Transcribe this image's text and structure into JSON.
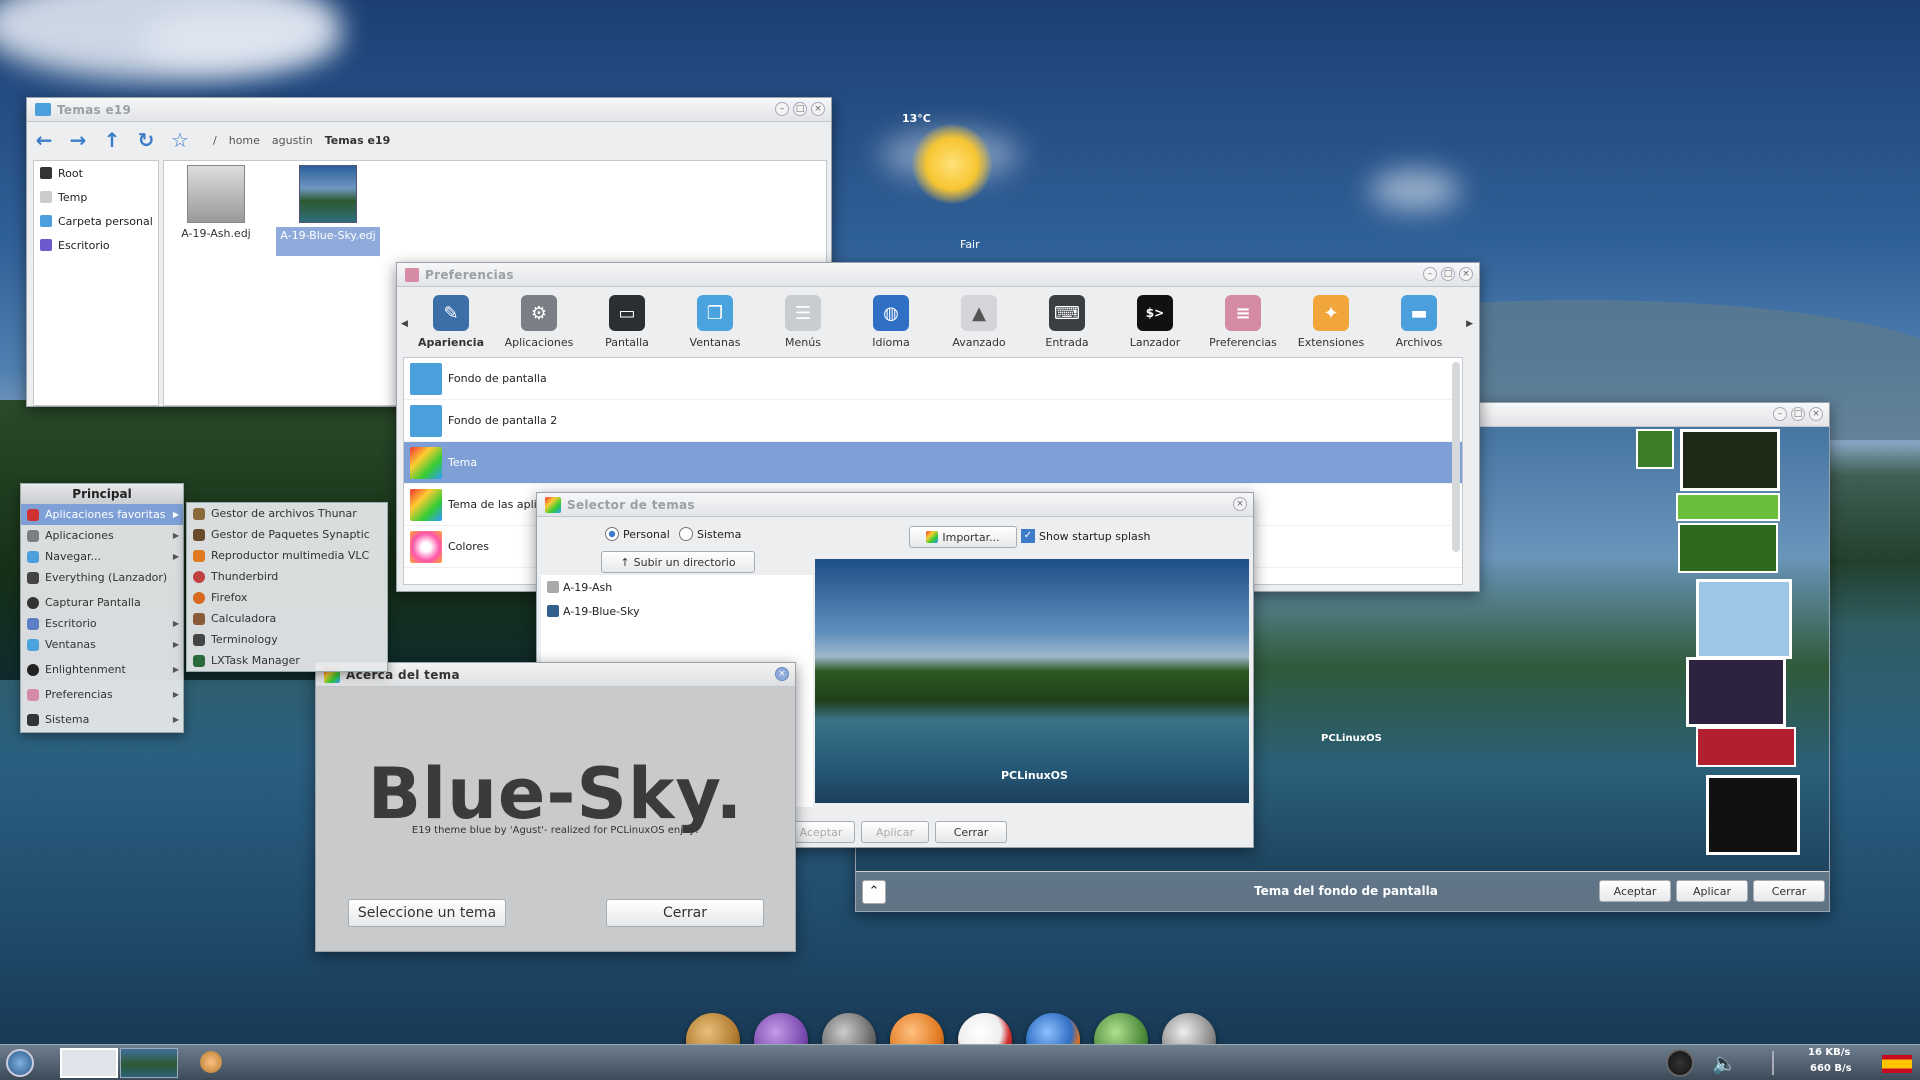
{
  "weather": {
    "temp": "13°C",
    "condition": "Fair"
  },
  "file_manager": {
    "title": "Temas e19",
    "path": [
      "/",
      "home",
      "agustin",
      "Temas e19"
    ],
    "sidebar": [
      "Root",
      "Temp",
      "Carpeta personal",
      "Escritorio"
    ],
    "files": [
      {
        "name": "A-19-Ash.edj",
        "selected": false
      },
      {
        "name": "A-19-Blue-Sky.edj",
        "selected": true
      }
    ]
  },
  "prefs": {
    "title": "Preferencias",
    "tabs": [
      {
        "label": "Apariencia",
        "icon": "appearance-icon",
        "color": "#3c6ea8"
      },
      {
        "label": "Aplicaciones",
        "icon": "gear-icon",
        "color": "#7a7f86"
      },
      {
        "label": "Pantalla",
        "icon": "screen-icon",
        "color": "#2b2f34"
      },
      {
        "label": "Ventanas",
        "icon": "windows-icon",
        "color": "#4aa3df"
      },
      {
        "label": "Menús",
        "icon": "menus-icon",
        "color": "#c9ccd0"
      },
      {
        "label": "Idioma",
        "icon": "language-icon",
        "color": "#2f6fc4"
      },
      {
        "label": "Avanzado",
        "icon": "rocket-icon",
        "color": "#d3d5d8"
      },
      {
        "label": "Entrada",
        "icon": "keyboard-icon",
        "color": "#3b3f44"
      },
      {
        "label": "Lanzador",
        "icon": "terminal-icon",
        "color": "#111111"
      },
      {
        "label": "Preferencias",
        "icon": "toggles-icon",
        "color": "#d58aa6"
      },
      {
        "label": "Extensiones",
        "icon": "puzzle-icon",
        "color": "#f0a63b"
      },
      {
        "label": "Archivos",
        "icon": "folder-icon",
        "color": "#4b9fdc"
      }
    ],
    "items": [
      {
        "label": "Fondo de pantalla",
        "selected": false
      },
      {
        "label": "Fondo de pantalla 2",
        "selected": false
      },
      {
        "label": "Tema",
        "selected": true
      },
      {
        "label": "Tema de las apli",
        "selected": false
      },
      {
        "label": "Colores",
        "selected": false
      }
    ]
  },
  "theme_selector": {
    "title": "Selector de temas",
    "radio_personal": "Personal",
    "radio_sistema": "Sistema",
    "import": "Importar...",
    "splash": "Show startup splash",
    "up_dir": "Subir un directorio",
    "themes": [
      "A-19-Ash",
      "A-19-Blue-Sky"
    ],
    "buttons": {
      "accept": "Aceptar",
      "apply": "Aplicar",
      "close": "Cerrar"
    }
  },
  "about": {
    "title": "Acerca del tema",
    "heading": "Blue-Sky.",
    "subtitle": "E19 theme  blue by 'Agust'- realized for PCLinuxOS enjoy!",
    "select": "Seleccione un tema",
    "close": "Cerrar"
  },
  "wallpaper_dialog": {
    "title": "Tema del fondo de pantalla",
    "buttons": {
      "accept": "Aceptar",
      "apply": "Aplicar",
      "close": "Cerrar"
    },
    "watermark": "PCLinuxOS"
  },
  "preview_watermark": "PCLinuxOS",
  "main_menu": {
    "title": "Principal",
    "items": [
      {
        "label": "Aplicaciones favoritas",
        "color": "#d03030",
        "sub": true,
        "active": true
      },
      {
        "label": "Aplicaciones",
        "color": "#7a7f86",
        "sub": true
      },
      {
        "label": "Navegar...",
        "color": "#4b9fdc",
        "sub": true
      },
      {
        "label": "Everything (Lanzador)",
        "color": "#444",
        "sub": false
      },
      {
        "label": "Capturar Pantalla",
        "color": "#333",
        "sub": false
      },
      {
        "label": "Escritorio",
        "color": "#5b7fc4",
        "sub": true
      },
      {
        "label": "Ventanas",
        "color": "#4aa3df",
        "sub": true
      },
      {
        "label": "Enlightenment",
        "color": "#222",
        "sub": true
      },
      {
        "label": "Preferencias",
        "color": "#d58aa6",
        "sub": true
      },
      {
        "label": "Sistema",
        "color": "#333",
        "sub": true
      }
    ]
  },
  "favorites_menu": {
    "items": [
      {
        "label": "Gestor de archivos Thunar",
        "color": "#8a6a3a"
      },
      {
        "label": "Gestor de Paquetes Synaptic",
        "color": "#6a4a2a"
      },
      {
        "label": "Reproductor multimedia VLC",
        "color": "#e07a20"
      },
      {
        "label": "Thunderbird",
        "color": "#c04040"
      },
      {
        "label": "Firefox",
        "color": "#d86a20"
      },
      {
        "label": "Calculadora",
        "color": "#8a5a3a"
      },
      {
        "label": "Terminology",
        "color": "#444"
      },
      {
        "label": "LXTask Manager",
        "color": "#2a6a3a"
      }
    ]
  },
  "taskbar": {
    "net_down": "16 KB/s",
    "net_up": "660 B/s"
  },
  "dock": [
    {
      "icon": "archive-icon",
      "color": "#b07a30"
    },
    {
      "icon": "media-icon",
      "color": "#7a4ab0"
    },
    {
      "icon": "settings-icon",
      "color": "#6a6a6a"
    },
    {
      "icon": "vlc-icon",
      "color": "#e07a20"
    },
    {
      "icon": "mail-icon",
      "color": "#d03030"
    },
    {
      "icon": "firefox-icon",
      "color": "#2f6fc4"
    },
    {
      "icon": "package-icon",
      "color": "#4a8a3a"
    },
    {
      "icon": "film-icon",
      "color": "#8a8a8a"
    }
  ]
}
